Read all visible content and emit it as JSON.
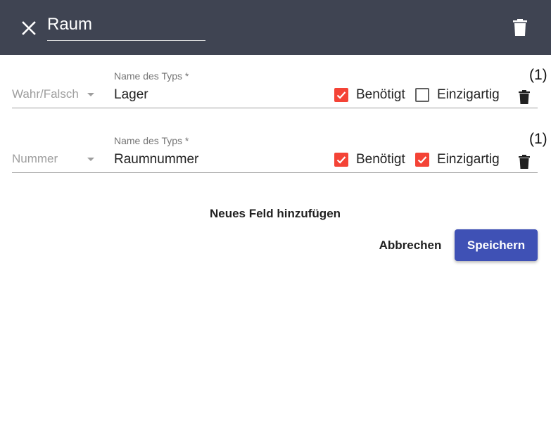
{
  "header": {
    "title_value": "Raum",
    "close_icon": "close-icon",
    "delete_icon": "trash-icon",
    "background": "#3f4452"
  },
  "fields": [
    {
      "type_value": "Wahr/Falsch",
      "name_label": "Name des Typs *",
      "name_value": "Lager",
      "required_label": "Benötigt",
      "required_checked": true,
      "unique_label": "Einzigartig",
      "unique_checked": false,
      "annotation": "(1)"
    },
    {
      "type_value": "Nummer",
      "name_label": "Name des Typs *",
      "name_value": "Raumnummer",
      "required_label": "Benötigt",
      "required_checked": true,
      "unique_label": "Einzigartig",
      "unique_checked": true,
      "annotation": "(1)"
    }
  ],
  "actions": {
    "add_field_label": "Neues Feld hinzufügen",
    "cancel_label": "Abbrechen",
    "save_label": "Speichern"
  },
  "colors": {
    "checkbox_accent": "#f44336",
    "primary": "#3f51b5"
  }
}
